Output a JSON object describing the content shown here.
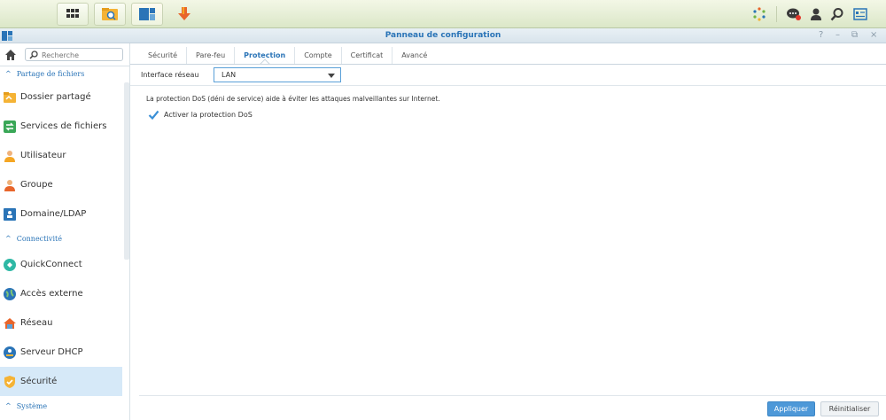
{
  "window": {
    "title": "Panneau de configuration",
    "controls": [
      "?",
      "–",
      "⧉",
      "×"
    ]
  },
  "sidebar": {
    "search_placeholder": "Recherche",
    "sections": [
      {
        "label": "Partage de fichiers"
      },
      {
        "label": "Connectivité"
      },
      {
        "label": "Système"
      }
    ],
    "items": [
      {
        "label": "Dossier partagé",
        "icon": "folder-icon"
      },
      {
        "label": "Services de fichiers",
        "icon": "file-services-icon"
      },
      {
        "label": "Utilisateur",
        "icon": "user-icon"
      },
      {
        "label": "Groupe",
        "icon": "group-icon"
      },
      {
        "label": "Domaine/LDAP",
        "icon": "domain-icon"
      },
      {
        "label": "QuickConnect",
        "icon": "quickconnect-icon"
      },
      {
        "label": "Accès externe",
        "icon": "globe-icon"
      },
      {
        "label": "Réseau",
        "icon": "network-house-icon"
      },
      {
        "label": "Serveur DHCP",
        "icon": "dhcp-icon"
      },
      {
        "label": "Sécurité",
        "icon": "shield-icon",
        "active": true
      }
    ]
  },
  "tabs": [
    {
      "label": "Sécurité"
    },
    {
      "label": "Pare-feu"
    },
    {
      "label": "Protection",
      "active": true
    },
    {
      "label": "Compte"
    },
    {
      "label": "Certificat"
    },
    {
      "label": "Avancé"
    }
  ],
  "content": {
    "interface_label": "Interface réseau",
    "interface_value": "LAN",
    "description": "La protection DoS (déni de service) aide à éviter les attaques malveillantes sur Internet.",
    "dos_checkbox_label": "Activer la protection DoS",
    "dos_checked": true
  },
  "footer": {
    "apply_label": "Appliquer",
    "reset_label": "Réinitialiser"
  },
  "colors": {
    "accent": "#2a74b7",
    "apply": "#4d98d8",
    "active_item_bg": "#d6e9f8"
  }
}
